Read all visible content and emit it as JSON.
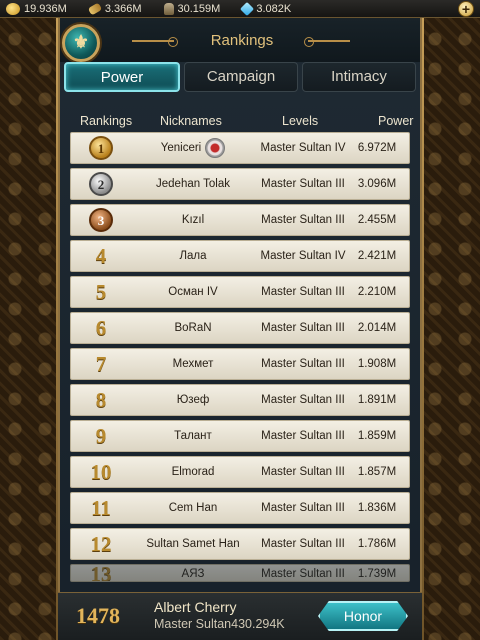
{
  "resources": {
    "gold": "19.936M",
    "grain": "3.366M",
    "soldiers": "30.159M",
    "gems": "3.082K",
    "add_icon": "+"
  },
  "header": {
    "title": "Rankings",
    "emblem_glyph": "⚜"
  },
  "tabs": [
    {
      "label": "Power",
      "active": true
    },
    {
      "label": "Campaign",
      "active": false
    },
    {
      "label": "Intimacy",
      "active": false
    }
  ],
  "columns": {
    "rank": "Rankings",
    "name": "Nicknames",
    "level": "Levels",
    "power": "Power"
  },
  "rows": [
    {
      "rank": "1",
      "name": "Yeniceri",
      "level": "Master Sultan IV",
      "power": "6.972M"
    },
    {
      "rank": "2",
      "name": "Jedehan Tolak",
      "level": "Master Sultan III",
      "power": "3.096M"
    },
    {
      "rank": "3",
      "name": "Kızıl",
      "level": "Master Sultan III",
      "power": "2.455M"
    },
    {
      "rank": "4",
      "name": "Лала",
      "level": "Master Sultan IV",
      "power": "2.421M"
    },
    {
      "rank": "5",
      "name": "Осман IV",
      "level": "Master Sultan III",
      "power": "2.210M"
    },
    {
      "rank": "6",
      "name": "BoRaN",
      "level": "Master Sultan III",
      "power": "2.014M"
    },
    {
      "rank": "7",
      "name": "Мехмет",
      "level": "Master Sultan III",
      "power": "1.908M"
    },
    {
      "rank": "8",
      "name": "Юзеф",
      "level": "Master Sultan III",
      "power": "1.891M"
    },
    {
      "rank": "9",
      "name": "Талант",
      "level": "Master Sultan III",
      "power": "1.859M"
    },
    {
      "rank": "10",
      "name": "Elmorad",
      "level": "Master Sultan III",
      "power": "1.857M"
    },
    {
      "rank": "11",
      "name": "Cem Han",
      "level": "Master Sultan III",
      "power": "1.836M"
    },
    {
      "rank": "12",
      "name": "Sultan Samet Han",
      "level": "Master Sultan III",
      "power": "1.786M"
    },
    {
      "rank": "13",
      "name": "АЯЗ",
      "level": "Master Sultan III",
      "power": "1.739M"
    }
  ],
  "me": {
    "rank": "1478",
    "name": "Albert Cherry",
    "info": "Master Sultan430.294K",
    "honor_label": "Honor"
  }
}
